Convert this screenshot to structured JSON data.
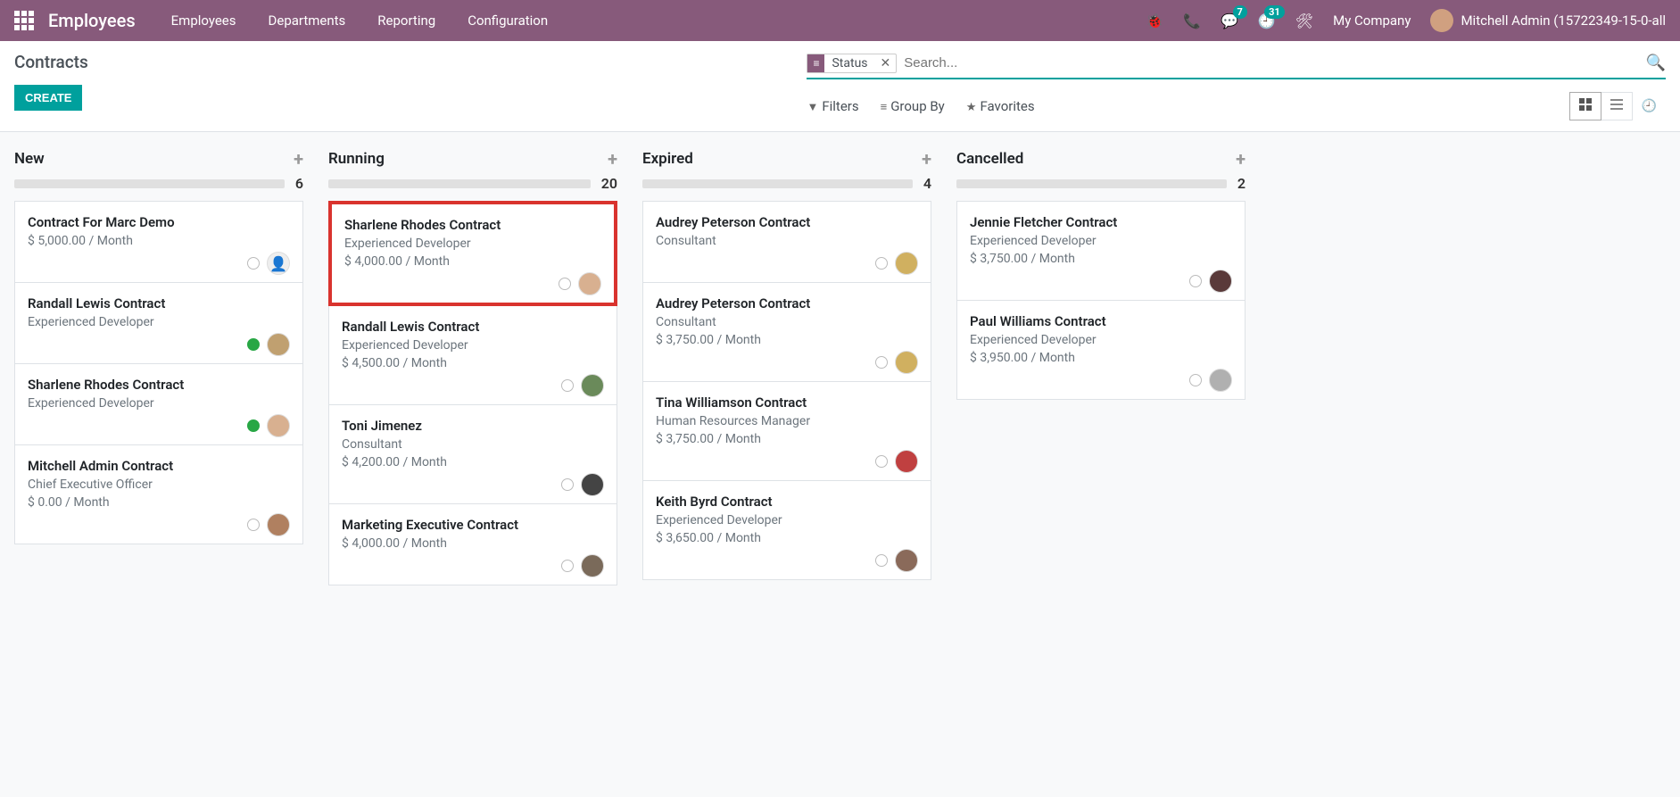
{
  "nav": {
    "app_title": "Employees",
    "menu": [
      "Employees",
      "Departments",
      "Reporting",
      "Configuration"
    ],
    "chat_badge": "7",
    "activity_badge": "31",
    "company": "My Company",
    "user": "Mitchell Admin (15722349-15-0-all"
  },
  "control": {
    "title": "Contracts",
    "create": "CREATE",
    "search_facet": "Status",
    "search_placeholder": "Search...",
    "filters": "Filters",
    "groupby": "Group By",
    "favorites": "Favorites"
  },
  "columns": [
    {
      "title": "New",
      "count": "6",
      "cards": [
        {
          "title": "Contract For Marc Demo",
          "role": "",
          "wage": "$ 5,000.00 / Month",
          "dot": "",
          "avatar": "blank"
        },
        {
          "title": "Randall Lewis Contract",
          "role": "Experienced Developer",
          "wage": "",
          "dot": "green",
          "avatar": "#c0a070"
        },
        {
          "title": "Sharlene Rhodes Contract",
          "role": "Experienced Developer",
          "wage": "",
          "dot": "green",
          "avatar": "#d8b090"
        },
        {
          "title": "Mitchell Admin Contract",
          "role": "Chief Executive Officer",
          "wage": "$ 0.00 / Month",
          "dot": "",
          "avatar": "#b08060"
        }
      ]
    },
    {
      "title": "Running",
      "count": "20",
      "cards": [
        {
          "title": "Sharlene Rhodes Contract",
          "role": "Experienced Developer",
          "wage": "$ 4,000.00 / Month",
          "dot": "",
          "avatar": "#d8b090",
          "hl": true
        },
        {
          "title": "Randall Lewis Contract",
          "role": "Experienced Developer",
          "wage": "$ 4,500.00 / Month",
          "dot": "",
          "avatar": "#6a8a5a"
        },
        {
          "title": "Toni Jimenez",
          "role": "Consultant",
          "wage": "$ 4,200.00 / Month",
          "dot": "",
          "avatar": "#444"
        },
        {
          "title": "Marketing Executive Contract",
          "role": "",
          "wage": "$ 4,000.00 / Month",
          "dot": "",
          "avatar": "#7a6a5a"
        }
      ]
    },
    {
      "title": "Expired",
      "count": "4",
      "cards": [
        {
          "title": "Audrey Peterson Contract",
          "role": "Consultant",
          "wage": "",
          "dot": "",
          "avatar": "#d0b060"
        },
        {
          "title": "Audrey Peterson Contract",
          "role": "Consultant",
          "wage": "$ 3,750.00 / Month",
          "dot": "",
          "avatar": "#d0b060"
        },
        {
          "title": "Tina Williamson Contract",
          "role": "Human Resources Manager",
          "wage": "$ 3,750.00 / Month",
          "dot": "",
          "avatar": "#c04040"
        },
        {
          "title": "Keith Byrd Contract",
          "role": "Experienced Developer",
          "wage": "$ 3,650.00 / Month",
          "dot": "",
          "avatar": "#8a6a5a"
        }
      ]
    },
    {
      "title": "Cancelled",
      "count": "2",
      "cards": [
        {
          "title": "Jennie Fletcher Contract",
          "role": "Experienced Developer",
          "wage": "$ 3,750.00 / Month",
          "dot": "",
          "avatar": "#5a3a3a"
        },
        {
          "title": "Paul Williams Contract",
          "role": "Experienced Developer",
          "wage": "$ 3,950.00 / Month",
          "dot": "",
          "avatar": "#b0b0b0"
        }
      ]
    }
  ]
}
